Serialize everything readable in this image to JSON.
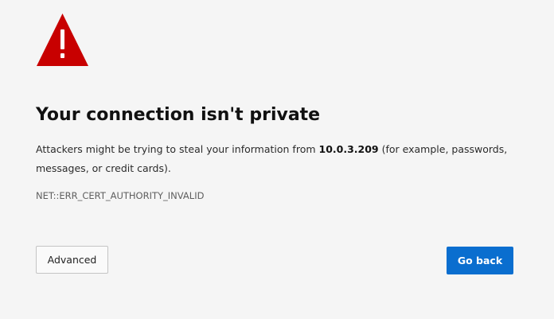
{
  "icon": {
    "name": "warning-icon",
    "color": "#c80000",
    "glyph": "!"
  },
  "page": {
    "title": "Your connection isn't private",
    "message_prefix": "Attackers might be trying to steal your information from ",
    "host": "10.0.3.209",
    "message_suffix": " (for example, passwords, messages, or credit cards).",
    "error_code": "NET::ERR_CERT_AUTHORITY_INVALID"
  },
  "buttons": {
    "advanced_label": "Advanced",
    "go_back_label": "Go back"
  },
  "colors": {
    "background": "#f5f5f5",
    "primary_button": "#0a6ecf",
    "warning_red": "#c80000"
  }
}
